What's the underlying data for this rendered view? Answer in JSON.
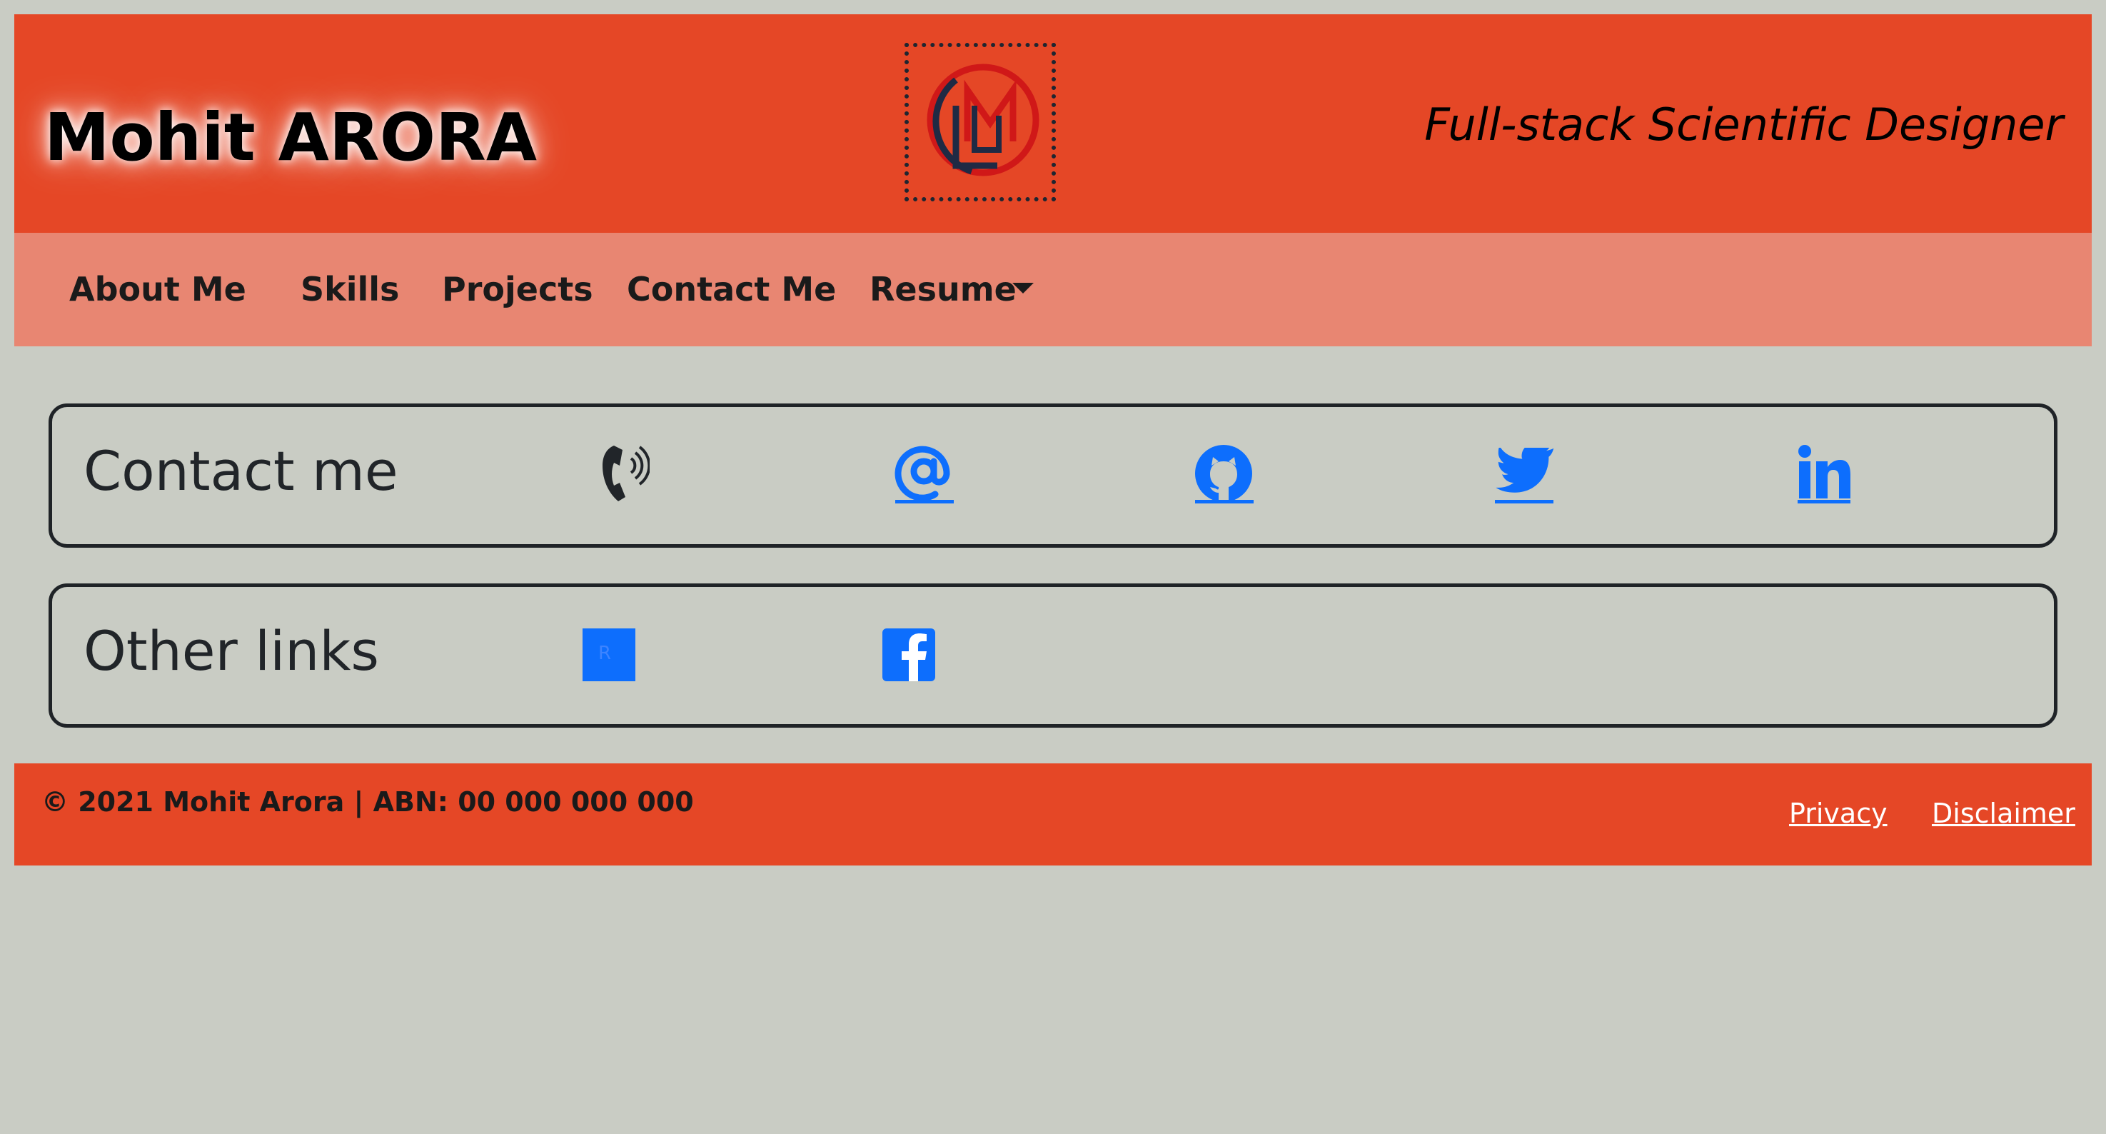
{
  "header": {
    "title": "Mohit ARORA",
    "tagline": "Full-stack Scientific Designer",
    "logo_letters": "LM"
  },
  "nav": {
    "items": [
      {
        "label": "About Me"
      },
      {
        "label": "Skills"
      },
      {
        "label": "Projects"
      },
      {
        "label": "Contact Me"
      },
      {
        "label": "Resume"
      }
    ]
  },
  "contact_card": {
    "title": "Contact me",
    "icons": [
      "phone-icon",
      "at-email-icon",
      "github-icon",
      "twitter-icon",
      "linkedin-icon"
    ]
  },
  "other_links_card": {
    "title": "Other links",
    "icons": [
      "researchgate-icon",
      "facebook-icon"
    ],
    "researchgate_glyph": "R"
  },
  "footer": {
    "copyright": "© 2021 Mohit Arora | ABN: 00 000 000 000",
    "links": [
      {
        "label": "Privacy"
      },
      {
        "label": "Disclaimer"
      }
    ]
  },
  "colors": {
    "header_bg": "#e54726",
    "nav_bg": "#e88672",
    "page_bg": "#c9ccc4",
    "link_blue": "#0d6efd",
    "logo_red": "#d01818",
    "logo_navy": "#1f2a44"
  }
}
